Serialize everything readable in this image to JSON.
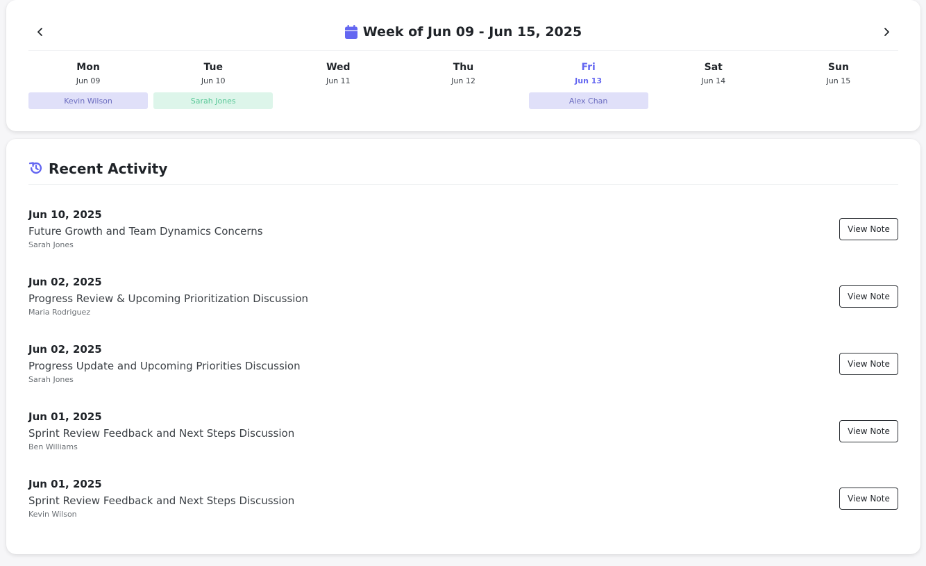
{
  "week": {
    "title": "Week of Jun 09 - Jun 15, 2025",
    "calendar_icon": "calendar-icon",
    "prev_icon": "chevron-left-icon",
    "next_icon": "chevron-right-icon",
    "accent_color": "#6366f1",
    "days": [
      {
        "name": "Mon",
        "date": "Jun 09",
        "event": "Kevin Wilson",
        "event_color": "indigo"
      },
      {
        "name": "Tue",
        "date": "Jun 10",
        "event": "Sarah Jones",
        "event_color": "green"
      },
      {
        "name": "Wed",
        "date": "Jun 11",
        "event": null,
        "event_color": null
      },
      {
        "name": "Thu",
        "date": "Jun 12",
        "event": null,
        "event_color": null
      },
      {
        "name": "Fri",
        "date": "Jun 13",
        "event": "Alex Chan",
        "event_color": "indigo",
        "today": true
      },
      {
        "name": "Sat",
        "date": "Jun 14",
        "event": null,
        "event_color": null
      },
      {
        "name": "Sun",
        "date": "Jun 15",
        "event": null,
        "event_color": null
      }
    ]
  },
  "activity": {
    "title": "Recent Activity",
    "icon": "history-icon",
    "button_label": "View Note",
    "items": [
      {
        "date": "Jun 10, 2025",
        "title": "Future Growth and Team Dynamics Concerns",
        "author": "Sarah Jones"
      },
      {
        "date": "Jun 02, 2025",
        "title": "Progress Review & Upcoming Prioritization Discussion",
        "author": "Maria Rodriguez"
      },
      {
        "date": "Jun 02, 2025",
        "title": "Progress Update and Upcoming Priorities Discussion",
        "author": "Sarah Jones"
      },
      {
        "date": "Jun 01, 2025",
        "title": "Sprint Review Feedback and Next Steps Discussion",
        "author": "Ben Williams"
      },
      {
        "date": "Jun 01, 2025",
        "title": "Sprint Review Feedback and Next Steps Discussion",
        "author": "Kevin Wilson"
      }
    ]
  }
}
